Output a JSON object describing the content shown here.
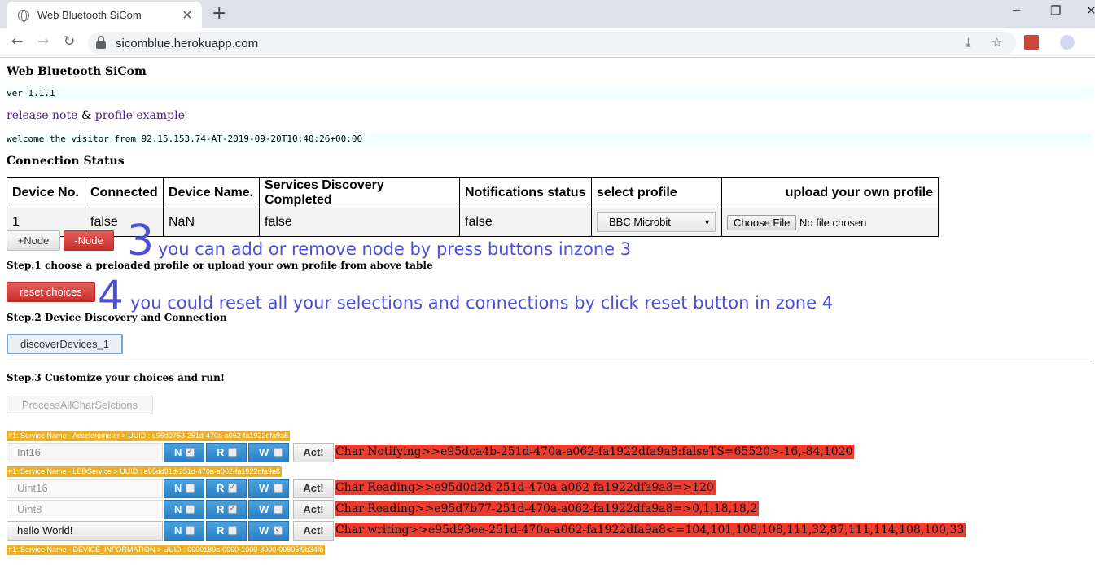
{
  "browser": {
    "tab_title": "Web Bluetooth SiCom",
    "url": "sicomblue.herokuapp.com"
  },
  "page": {
    "title": "Web Bluetooth SiCom",
    "version": "ver 1.1.1",
    "link_release": "release note",
    "link_sep": "&",
    "link_profile": "profile example",
    "welcome": "welcome the visitor from 92.15.153.74-AT-2019-09-20T10:40:26+00:00",
    "connection_status": "Connection Status",
    "table": {
      "headers": [
        "Device No.",
        "Connected",
        "Device Name.",
        "Services Discovery Completed",
        "Notifications status",
        "select profile",
        "upload your own profile"
      ],
      "row": [
        "1",
        "false",
        "NaN",
        "false",
        "false"
      ],
      "profile_selected": "BBC Microbit",
      "file_button": "Choose File",
      "file_status": "No file chosen"
    },
    "add_node": "+Node",
    "remove_node": "-Node",
    "step1": "Step.1 choose a preloaded profile or upload your own profile from above table",
    "reset_choices": "reset choices",
    "step2": "Step.2 Device Discovery and Connection",
    "discover": "discoverDevices_1",
    "step3": "Step.3 Customize your choices and run!",
    "process_all": "ProcessAllCharSelctions"
  },
  "annotations": {
    "zone3_num": "3",
    "zone3_text": "you can add or remove node by press buttons inzone 3",
    "zone4_num": "4",
    "zone4_text": "you could reset all your selections and connections by click reset button in zone 4"
  },
  "services": [
    {
      "label": "#1: Service Name - Accelerometer > UUID : e95d0753-251d-470a-a062-fa1922dfa9a8"
    },
    {
      "label": "#1: Service Name - LEDService > UUID : e95dd91d-251d-470a-a062-fa1922dfa9a8"
    },
    {
      "label": "#1: Service Name - DEVICE_INFORMATION > UUID : 0000180a-0000-1000-8000-00805f9b34fb"
    }
  ],
  "characteristics": [
    {
      "field": "Int16",
      "n": "N",
      "r": "R",
      "w": "W",
      "n_checked": true,
      "r_checked": false,
      "w_checked": false,
      "act": "Act!",
      "result": "Char Notifying>>e95dca4b-251d-470a-a062-fa1922dfa9a8:falseTS=65520>-16,-84,1020"
    },
    {
      "field": "Uint16",
      "n": "N",
      "r": "R",
      "w": "W",
      "n_checked": false,
      "r_checked": true,
      "w_checked": false,
      "act": "Act!",
      "result": "Char Reading>>e95d0d2d-251d-470a-a062-fa1922dfa9a8=>120"
    },
    {
      "field": "Uint8",
      "n": "N",
      "r": "R",
      "w": "W",
      "n_checked": false,
      "r_checked": true,
      "w_checked": false,
      "act": "Act!",
      "result": "Char Reading>>e95d7b77-251d-470a-a062-fa1922dfa9a8=>0,1,18,18,2"
    },
    {
      "field": "hello World!",
      "n": "N",
      "r": "R",
      "w": "W",
      "n_checked": false,
      "r_checked": false,
      "w_checked": true,
      "act": "Act!",
      "result": "Char writing>>e95d93ee-251d-470a-a062-fa1922dfa9a8<=104,101,108,108,111,32,87,111,114,108,100,33"
    }
  ]
}
